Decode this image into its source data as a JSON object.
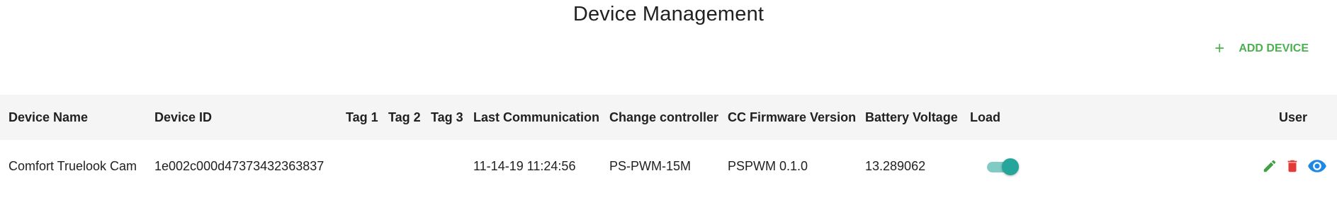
{
  "page": {
    "title": "Device Management"
  },
  "toolbar": {
    "add_label": "ADD DEVICE",
    "add_icon": "plus-icon",
    "accent_color": "#4caf50"
  },
  "table": {
    "columns": [
      "Device Name",
      "Device ID",
      "Tag 1",
      "Tag 2",
      "Tag 3",
      "Last Communication",
      "Change controller",
      "CC Firmware Version",
      "Battery Voltage",
      "Load",
      "User"
    ],
    "rows": [
      {
        "device_name": "Comfort Truelook Cam",
        "device_id": "1e002c000d47373432363837",
        "tag1": "",
        "tag2": "",
        "tag3": "",
        "last_communication": "11-14-19 11:24:56",
        "change_controller": "PS-PWM-15M",
        "cc_firmware_version": "PSPWM 0.1.0",
        "battery_voltage": "13.289062",
        "load_on": true,
        "actions": [
          {
            "icon": "pencil-icon",
            "color": "#43a047"
          },
          {
            "icon": "trash-icon",
            "color": "#e53935"
          },
          {
            "icon": "eye-icon",
            "color": "#1e88e5"
          }
        ]
      }
    ]
  }
}
